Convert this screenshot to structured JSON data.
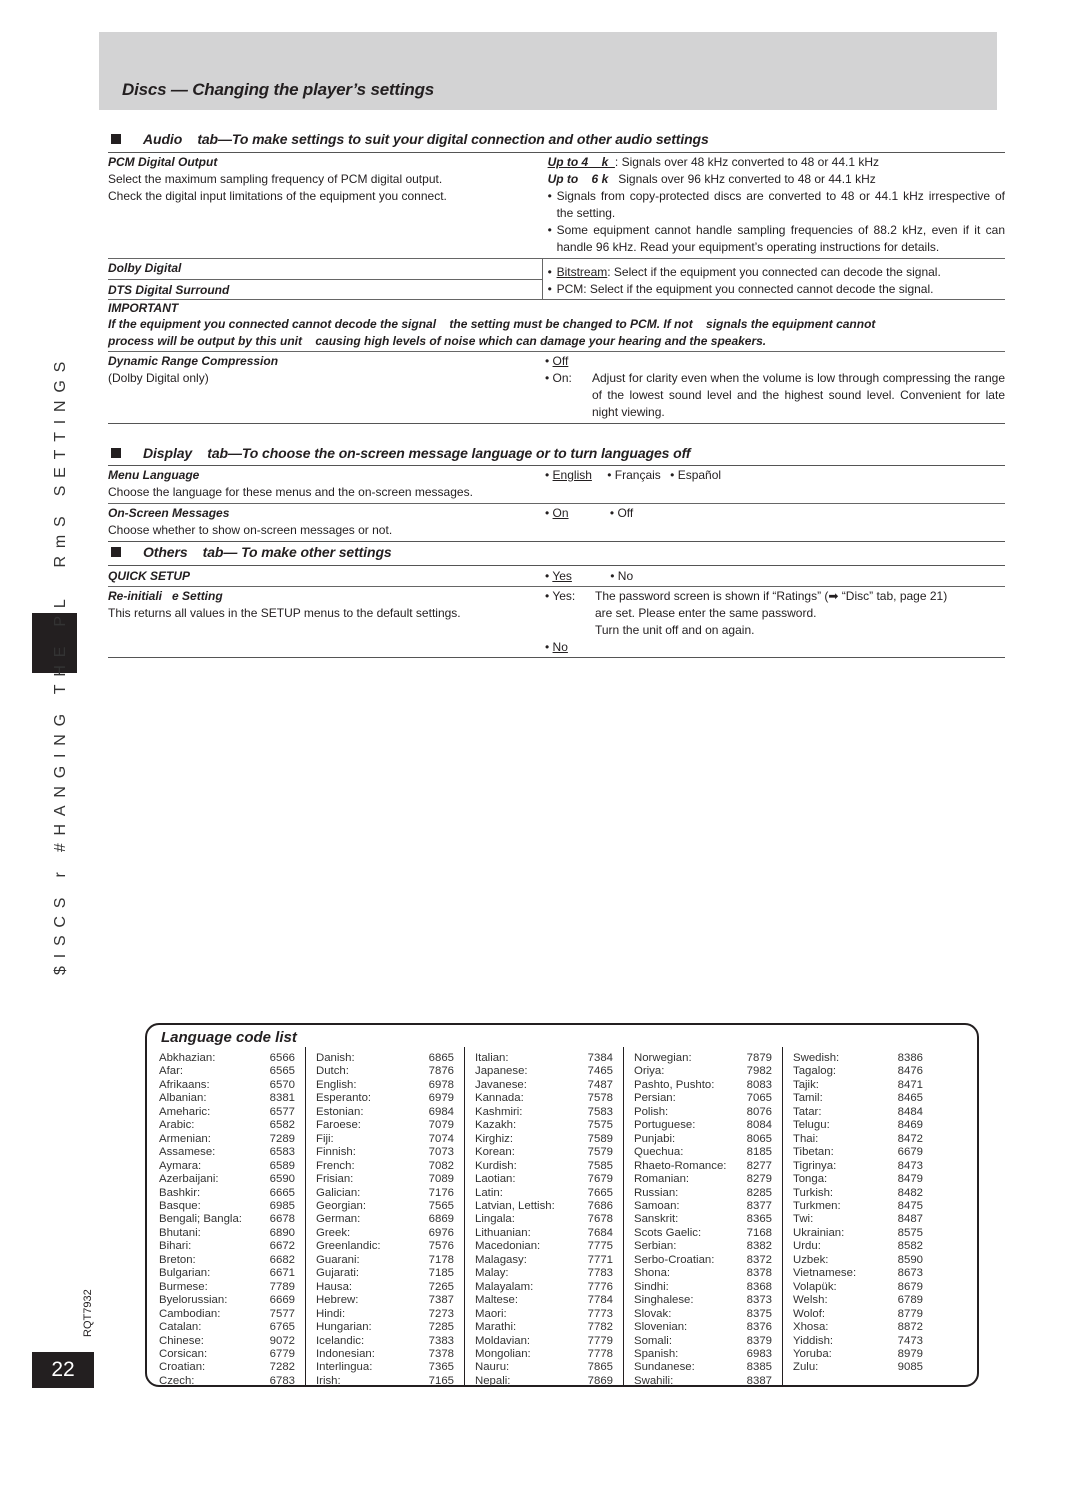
{
  "header": {
    "title": "Discs — Changing the player’s settings"
  },
  "sidebar": {
    "running_text": "$ISCS r #HANGING THE PL  RmS SETTINGS",
    "doc_code": "RQT7932",
    "page_number": "22"
  },
  "audio_section": {
    "heading": "Audio    tab—To make settings to suit your digital connection and other audio settings",
    "pcm": {
      "title": "PCM Digital Output",
      "desc1": "Select the maximum sampling frequency of PCM digital output.",
      "desc2": "Check the digital input limitations of the equipment you connect.",
      "opt1_label": "Up to 4    k  ",
      "opt1_text": ": Signals over 48 kHz converted to 48 or 44.1 kHz",
      "opt2_label": "Up to    6 k",
      "opt2_text": "Signals over 96 kHz converted to 48 or 44.1 kHz",
      "note1": "Signals from copy-protected discs are converted to 48 or 44.1 kHz irrespective of the setting.",
      "note2": "Some equipment cannot handle sampling frequencies of 88.2 kHz, even if it can handle 96 kHz. Read your equipment’s operating instructions for details."
    },
    "dolby": {
      "title1": "Dolby Digital",
      "title2": "DTS Digital Surround",
      "opt1_label": "Bitstream",
      "opt1_text": ": Select if the equipment you connected can decode the signal.",
      "opt2_text": "PCM: Select if the equipment you connected cannot decode the signal."
    },
    "important": {
      "title": "IMPORTANT",
      "line1": "If the equipment you connected cannot decode the signal    the setting must be changed to PCM. If not    signals the equipment cannot",
      "line2": "process will be output by this unit    causing high levels of noise which can damage your hearing and the speakers."
    },
    "drc": {
      "title": "Dynamic Range Compression",
      "subtitle": "(Dolby Digital only)",
      "opt_off": "Off",
      "opt_on_label": "On:",
      "opt_on_text": "Adjust for clarity even when the volume is low through compressing the range of the lowest sound level and the highest sound level. Convenient for late night viewing."
    }
  },
  "display_section": {
    "heading": "Display    tab—To choose the on-screen message language or to turn languages off",
    "menu_language": {
      "title": "Menu Language",
      "desc": "Choose the language for these menus and the on-screen messages.",
      "options": [
        "English",
        "Français",
        "Español"
      ]
    },
    "osm": {
      "title": "On-Screen Messages",
      "desc": "Choose whether to show on-screen messages or not.",
      "options": [
        "On",
        "Off"
      ]
    }
  },
  "others_section": {
    "heading": "Others    tab— To make other settings",
    "quick_setup": {
      "title": "QUICK SETUP",
      "options": [
        "Yes",
        "No"
      ]
    },
    "reinit": {
      "title": "Re-initiali   e Setting",
      "desc": "This returns all values in the SETUP menus to the default settings.",
      "yes_label": "Yes:",
      "yes_line1": "The password screen is shown if “Ratings” (➡ “Disc” tab, page 21)",
      "yes_line2": "are set. Please enter the same password.",
      "yes_line3": "Turn the unit off and on again.",
      "no_label": "No"
    }
  },
  "language_list": {
    "title": "Language code list",
    "columns": [
      [
        [
          "Abkhazian:",
          "6566"
        ],
        [
          "Afar:",
          "6565"
        ],
        [
          "Afrikaans:",
          "6570"
        ],
        [
          "Albanian:",
          "8381"
        ],
        [
          "Ameharic:",
          "6577"
        ],
        [
          "Arabic:",
          "6582"
        ],
        [
          "Armenian:",
          "7289"
        ],
        [
          "Assamese:",
          "6583"
        ],
        [
          "Aymara:",
          "6589"
        ],
        [
          "Azerbaijani:",
          "6590"
        ],
        [
          "Bashkir:",
          "6665"
        ],
        [
          "Basque:",
          "6985"
        ],
        [
          "Bengali; Bangla:",
          "6678"
        ],
        [
          "Bhutani:",
          "6890"
        ],
        [
          "Bihari:",
          "6672"
        ],
        [
          "Breton:",
          "6682"
        ],
        [
          "Bulgarian:",
          "6671"
        ],
        [
          "Burmese:",
          "7789"
        ],
        [
          "Byelorussian:",
          "6669"
        ],
        [
          "Cambodian:",
          "7577"
        ],
        [
          "Catalan:",
          "6765"
        ],
        [
          "Chinese:",
          "9072"
        ],
        [
          "Corsican:",
          "6779"
        ],
        [
          "Croatian:",
          "7282"
        ],
        [
          "Czech:",
          "6783"
        ]
      ],
      [
        [
          "Danish:",
          "6865"
        ],
        [
          "Dutch:",
          "7876"
        ],
        [
          "English:",
          "6978"
        ],
        [
          "Esperanto:",
          "6979"
        ],
        [
          "Estonian:",
          "6984"
        ],
        [
          "Faroese:",
          "7079"
        ],
        [
          "Fiji:",
          "7074"
        ],
        [
          "Finnish:",
          "7073"
        ],
        [
          "French:",
          "7082"
        ],
        [
          "Frisian:",
          "7089"
        ],
        [
          "Galician:",
          "7176"
        ],
        [
          "Georgian:",
          "7565"
        ],
        [
          "German:",
          "6869"
        ],
        [
          "Greek:",
          "6976"
        ],
        [
          "Greenlandic:",
          "7576"
        ],
        [
          "Guarani:",
          "7178"
        ],
        [
          "Gujarati:",
          "7185"
        ],
        [
          "Hausa:",
          "7265"
        ],
        [
          "Hebrew:",
          "7387"
        ],
        [
          "Hindi:",
          "7273"
        ],
        [
          "Hungarian:",
          "7285"
        ],
        [
          "Icelandic:",
          "7383"
        ],
        [
          "Indonesian:",
          "7378"
        ],
        [
          "Interlingua:",
          "7365"
        ],
        [
          "Irish:",
          "7165"
        ]
      ],
      [
        [
          "Italian:",
          "7384"
        ],
        [
          "Japanese:",
          "7465"
        ],
        [
          "Javanese:",
          "7487"
        ],
        [
          "Kannada:",
          "7578"
        ],
        [
          "Kashmiri:",
          "7583"
        ],
        [
          "Kazakh:",
          "7575"
        ],
        [
          "Kirghiz:",
          "7589"
        ],
        [
          "Korean:",
          "7579"
        ],
        [
          "Kurdish:",
          "7585"
        ],
        [
          "Laotian:",
          "7679"
        ],
        [
          "Latin:",
          "7665"
        ],
        [
          "Latvian, Lettish:",
          "7686"
        ],
        [
          "Lingala:",
          "7678"
        ],
        [
          "Lithuanian:",
          "7684"
        ],
        [
          "Macedonian:",
          "7775"
        ],
        [
          "Malagasy:",
          "7771"
        ],
        [
          "Malay:",
          "7783"
        ],
        [
          "Malayalam:",
          "7776"
        ],
        [
          "Maltese:",
          "7784"
        ],
        [
          "Maori:",
          "7773"
        ],
        [
          "Marathi:",
          "7782"
        ],
        [
          "Moldavian:",
          "7779"
        ],
        [
          "Mongolian:",
          "7778"
        ],
        [
          "Nauru:",
          "7865"
        ],
        [
          "Nepali:",
          "7869"
        ]
      ],
      [
        [
          "Norwegian:",
          "7879"
        ],
        [
          "Oriya:",
          "7982"
        ],
        [
          "Pashto, Pushto:",
          "8083"
        ],
        [
          "Persian:",
          "7065"
        ],
        [
          "Polish:",
          "8076"
        ],
        [
          "Portuguese:",
          "8084"
        ],
        [
          "Punjabi:",
          "8065"
        ],
        [
          "Quechua:",
          "8185"
        ],
        [
          "Rhaeto-Romance:",
          "8277"
        ],
        [
          "Romanian:",
          "8279"
        ],
        [
          "Russian:",
          "8285"
        ],
        [
          "Samoan:",
          "8377"
        ],
        [
          "Sanskrit:",
          "8365"
        ],
        [
          "Scots Gaelic:",
          "7168"
        ],
        [
          "Serbian:",
          "8382"
        ],
        [
          "Serbo-Croatian:",
          "8372"
        ],
        [
          "Shona:",
          "8378"
        ],
        [
          "Sindhi:",
          "8368"
        ],
        [
          "Singhalese:",
          "8373"
        ],
        [
          "Slovak:",
          "8375"
        ],
        [
          "Slovenian:",
          "8376"
        ],
        [
          "Somali:",
          "8379"
        ],
        [
          "Spanish:",
          "6983"
        ],
        [
          "Sundanese:",
          "8385"
        ],
        [
          "Swahili:",
          "8387"
        ]
      ],
      [
        [
          "Swedish:",
          "8386"
        ],
        [
          "Tagalog:",
          "8476"
        ],
        [
          "Tajik:",
          "8471"
        ],
        [
          "Tamil:",
          "8465"
        ],
        [
          "Tatar:",
          "8484"
        ],
        [
          "Telugu:",
          "8469"
        ],
        [
          "Thai:",
          "8472"
        ],
        [
          "Tibetan:",
          "6679"
        ],
        [
          "Tigrinya:",
          "8473"
        ],
        [
          "Tonga:",
          "8479"
        ],
        [
          "Turkish:",
          "8482"
        ],
        [
          "Turkmen:",
          "8475"
        ],
        [
          "Twi:",
          "8487"
        ],
        [
          "Ukrainian:",
          "8575"
        ],
        [
          "Urdu:",
          "8582"
        ],
        [
          "Uzbek:",
          "8590"
        ],
        [
          "Vietnamese:",
          "8673"
        ],
        [
          "Volapük:",
          "8679"
        ],
        [
          "Welsh:",
          "6789"
        ],
        [
          "Wolof:",
          "8779"
        ],
        [
          "Xhosa:",
          "8872"
        ],
        [
          "Yiddish:",
          "7473"
        ],
        [
          "Yoruba:",
          "8979"
        ],
        [
          "Zulu:",
          "9085"
        ]
      ]
    ]
  }
}
